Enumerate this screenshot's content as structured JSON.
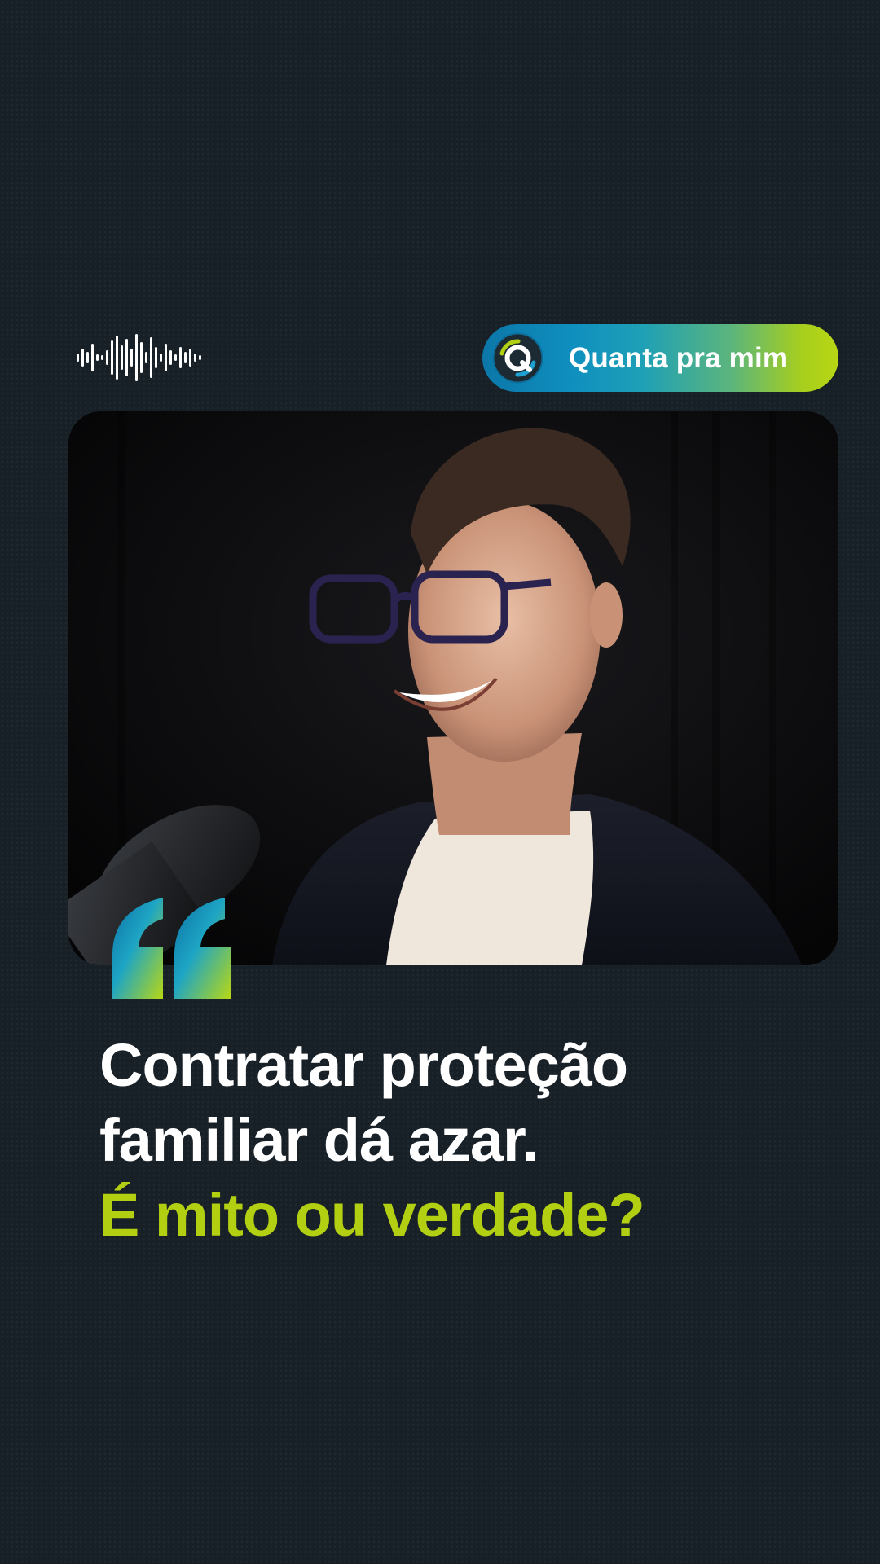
{
  "brand": {
    "name": "Quanta pra mim",
    "logo_icon": "quanta-logo-icon"
  },
  "header": {
    "waveform_icon": "audio-waveform-icon"
  },
  "photo": {
    "description_icon": "podcast-guest-photo",
    "microphone_icon": "microphone-icon"
  },
  "quote": {
    "icon": "quote-mark-icon",
    "line1": "Contratar proteção",
    "line2": "familiar dá azar.",
    "highlight": "É mito ou verdade?"
  },
  "colors": {
    "background": "#182027",
    "accent_lime": "#b2cf12",
    "accent_blue": "#0b77a8",
    "text_white": "#ffffff"
  }
}
